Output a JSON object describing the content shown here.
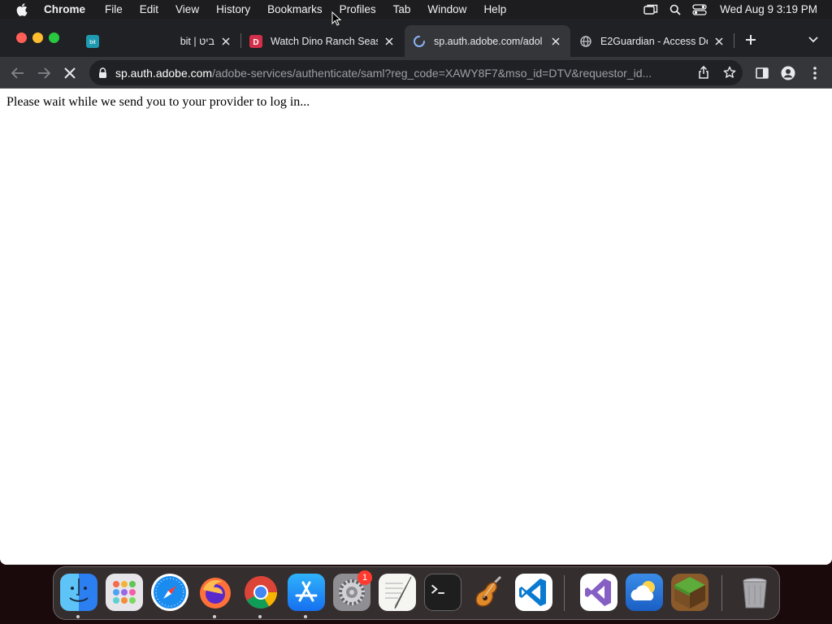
{
  "menubar": {
    "app_name": "Chrome",
    "items": [
      "File",
      "Edit",
      "View",
      "History",
      "Bookmarks",
      "Profiles",
      "Tab",
      "Window",
      "Help"
    ],
    "clock": "Wed Aug 9  3:19 PM"
  },
  "tabs": [
    {
      "title": "bit | ביט",
      "favicon": "bit-favicon",
      "active": false
    },
    {
      "title": "Watch Dino Ranch Seas",
      "favicon": "disney-plus-favicon",
      "active": false
    },
    {
      "title": "sp.auth.adobe.com/adol",
      "favicon": "loading-spinner-icon",
      "active": true
    },
    {
      "title": "E2Guardian - Access De",
      "favicon": "globe-icon",
      "active": false
    }
  ],
  "address_bar": {
    "host": "sp.auth.adobe.com",
    "path": "/adobe-services/authenticate/saml?reg_code=XAWY8F7&mso_id=DTV&requestor_id..."
  },
  "page": {
    "message": "Please wait while we send you to your provider to log in..."
  },
  "dock": {
    "apps": [
      "Finder",
      "Launchpad",
      "Safari",
      "Firefox",
      "Google Chrome",
      "App Store",
      "System Settings",
      "TextEdit",
      "Terminal",
      "GarageBand",
      "Visual Studio Code",
      "Visual Studio",
      "Weather",
      "Minecraft",
      "Trash"
    ],
    "system_settings_badge": "1"
  },
  "colors": {
    "tabstrip": "#202124",
    "toolbar": "#35363a",
    "omnibox": "#202124",
    "close_red": "#ff5f57",
    "minimize_yellow": "#febc2e",
    "zoom_green": "#28c840",
    "badge_red": "#ff3b30"
  }
}
